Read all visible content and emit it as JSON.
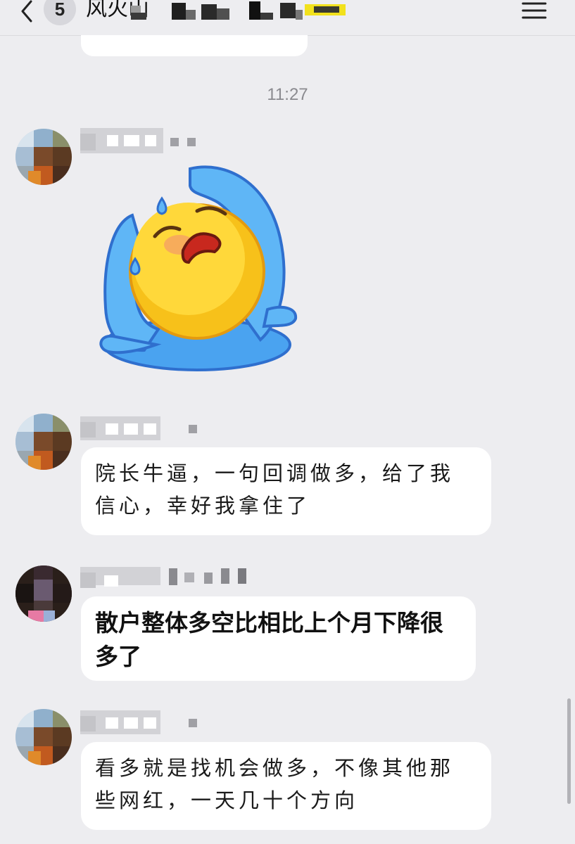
{
  "header": {
    "unread_count": "5",
    "title": "风火山"
  },
  "timestamp": "11:27",
  "messages": [
    {
      "type": "sticker",
      "sticker_icon": "crying-emoji-sticker"
    },
    {
      "type": "text",
      "text": "院长牛逼，一句回调做多，给了我信心，幸好我拿住了"
    },
    {
      "type": "text",
      "text": "散户整体多空比相比上个月下降很多了"
    },
    {
      "type": "text",
      "text": "看多就是找机会做多，不像其他那些网红，一天几十个方向"
    }
  ],
  "colors": {
    "background": "#ededf0",
    "bubble": "#ffffff",
    "timestamp_text": "#8a8a8f"
  }
}
